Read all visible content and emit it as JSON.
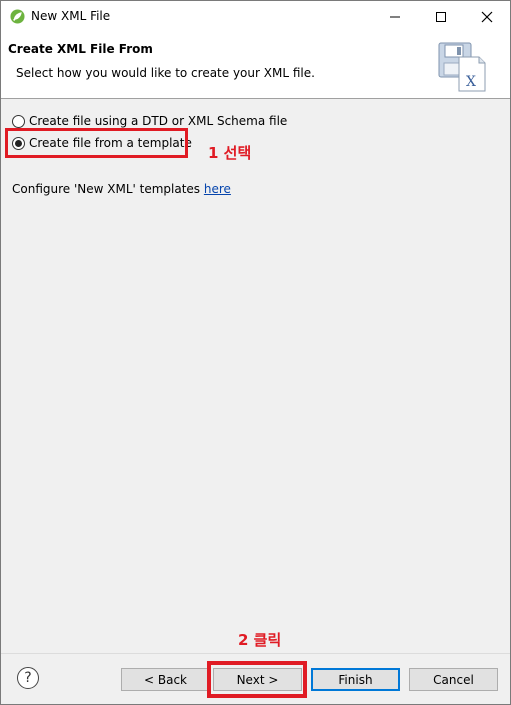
{
  "window": {
    "title": "New XML File"
  },
  "banner": {
    "title": "Create XML File From",
    "description": "Select how you would like to create your XML file."
  },
  "options": {
    "dtd_label": "Create file using a DTD or XML Schema file",
    "template_label": "Create file from a template",
    "selected": "template"
  },
  "config": {
    "text": "Configure 'New XML' templates ",
    "link": "here"
  },
  "annotations": {
    "step1": "1 선택",
    "step2": "2 클릭"
  },
  "buttons": {
    "back": "< Back",
    "next": "Next >",
    "finish": "Finish",
    "cancel": "Cancel",
    "help": "?"
  },
  "colors": {
    "highlight": "#e01b24",
    "link": "#0645ad",
    "default_button_border": "#0078d7"
  }
}
